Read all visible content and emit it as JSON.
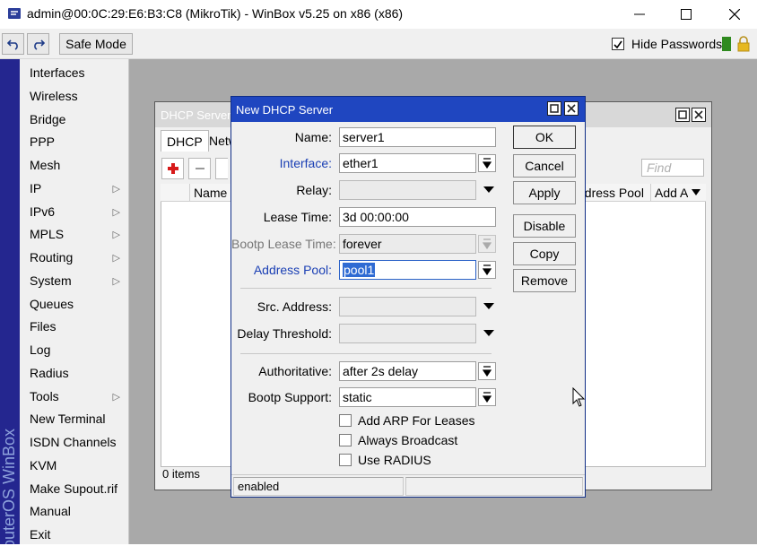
{
  "app": {
    "window_title": "admin@00:0C:29:E6:B3:C8 (MikroTik) - WinBox v5.25 on x86 (x86)",
    "brand_vertical": "RouterOS WinBox"
  },
  "toolbar": {
    "undo_icon": "undo-icon",
    "redo_icon": "redo-icon",
    "safe_mode_label": "Safe Mode",
    "hide_passwords_label": "Hide Passwords",
    "hide_passwords_checked": true
  },
  "menu": {
    "items": [
      {
        "label": "Interfaces",
        "submenu": false
      },
      {
        "label": "Wireless",
        "submenu": false
      },
      {
        "label": "Bridge",
        "submenu": false
      },
      {
        "label": "PPP",
        "submenu": false
      },
      {
        "label": "Mesh",
        "submenu": false
      },
      {
        "label": "IP",
        "submenu": true
      },
      {
        "label": "IPv6",
        "submenu": true
      },
      {
        "label": "MPLS",
        "submenu": true
      },
      {
        "label": "Routing",
        "submenu": true
      },
      {
        "label": "System",
        "submenu": true
      },
      {
        "label": "Queues",
        "submenu": false
      },
      {
        "label": "Files",
        "submenu": false
      },
      {
        "label": "Log",
        "submenu": false
      },
      {
        "label": "Radius",
        "submenu": false
      },
      {
        "label": "Tools",
        "submenu": true
      },
      {
        "label": "New Terminal",
        "submenu": false
      },
      {
        "label": "ISDN Channels",
        "submenu": false
      },
      {
        "label": "KVM",
        "submenu": false
      },
      {
        "label": "Make Supout.rif",
        "submenu": false
      },
      {
        "label": "Manual",
        "submenu": false
      },
      {
        "label": "Exit",
        "submenu": false
      }
    ]
  },
  "dhcp_window": {
    "title": "DHCP Server",
    "tabs": [
      "DHCP",
      "Netw"
    ],
    "find_placeholder": "Find",
    "columns": [
      "Name",
      "ddress Pool",
      "Add AR"
    ],
    "items_count": "0 items"
  },
  "dialog": {
    "title": "New DHCP Server",
    "fields": {
      "name": {
        "label": "Name:",
        "value": "server1"
      },
      "interface": {
        "label": "Interface:",
        "value": "ether1"
      },
      "relay": {
        "label": "Relay:",
        "value": ""
      },
      "lease_time": {
        "label": "Lease Time:",
        "value": "3d 00:00:00"
      },
      "bootp_lease_time": {
        "label": "Bootp Lease Time:",
        "value": "forever"
      },
      "address_pool": {
        "label": "Address Pool:",
        "value": "pool1"
      },
      "src_address": {
        "label": "Src. Address:",
        "value": ""
      },
      "delay_threshold": {
        "label": "Delay Threshold:",
        "value": ""
      },
      "authoritative": {
        "label": "Authoritative:",
        "value": "after 2s delay"
      },
      "bootp_support": {
        "label": "Bootp Support:",
        "value": "static"
      }
    },
    "checkboxes": {
      "add_arp": {
        "label": "Add ARP For Leases",
        "checked": false
      },
      "always_broadcast": {
        "label": "Always Broadcast",
        "checked": false
      },
      "use_radius": {
        "label": "Use RADIUS",
        "checked": false
      }
    },
    "buttons": {
      "ok": "OK",
      "cancel": "Cancel",
      "apply": "Apply",
      "disable": "Disable",
      "copy": "Copy",
      "remove": "Remove"
    },
    "status": "enabled"
  },
  "colors": {
    "brand_strip": "#24268f",
    "dialog_title": "#1f46c0",
    "link_label": "#1a3fb4",
    "selection": "#2f6bd3",
    "add_button_red": "#d71a1a",
    "lock_yellow": "#e6b821",
    "status_green": "#2f8a1f"
  }
}
